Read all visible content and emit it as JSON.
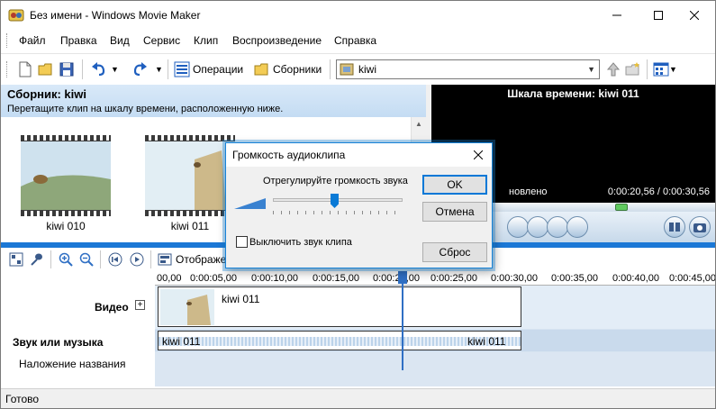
{
  "window": {
    "title": "Без имени - Windows Movie Maker"
  },
  "menu": [
    "Файл",
    "Правка",
    "Вид",
    "Сервис",
    "Клип",
    "Воспроизведение",
    "Справка"
  ],
  "toolbar": {
    "operations_label": "Операции",
    "collections_label": "Сборники",
    "collection_combo_value": "kiwi"
  },
  "collection": {
    "title": "Сборник: kiwi",
    "subtitle": "Перетащите клип на шкалу времени, расположенную ниже.",
    "clips": [
      {
        "label": "kiwi 010"
      },
      {
        "label": "kiwi 011"
      }
    ]
  },
  "preview": {
    "title": "Шкала времени: kiwi 011",
    "status": "новлено",
    "time": "0:00:20,56 / 0:00:30,56"
  },
  "timeline_toolbar": {
    "label": "Отображе"
  },
  "ruler": {
    "ticks": [
      "00,00",
      "0:00:05,00",
      "0:00:10,00",
      "0:00:15,00",
      "0:00:20,00",
      "0:00:25,00",
      "0:00:30,00",
      "0:00:35,00",
      "0:00:40,00",
      "0:00:45,00"
    ]
  },
  "tracks": {
    "video": "Видео",
    "audio": "Звук или музыка",
    "title_overlay": "Наложение названия",
    "video_clip": "kiwi 011",
    "audio_clip_start": "kiwi 011",
    "audio_clip_end": "kiwi 011"
  },
  "status": "Готово",
  "dialog": {
    "title": "Громкость аудиоклипа",
    "prompt": "Отрегулируйте громкость звука",
    "mute_label": "Выключить звук клипа",
    "mute_checked": false,
    "ok": "OK",
    "cancel": "Отмена",
    "reset": "Сброс"
  },
  "colors": {
    "accent": "#1b78d6",
    "dialog_border": "#1883d7",
    "slider_thumb": "#0a7ad6"
  }
}
